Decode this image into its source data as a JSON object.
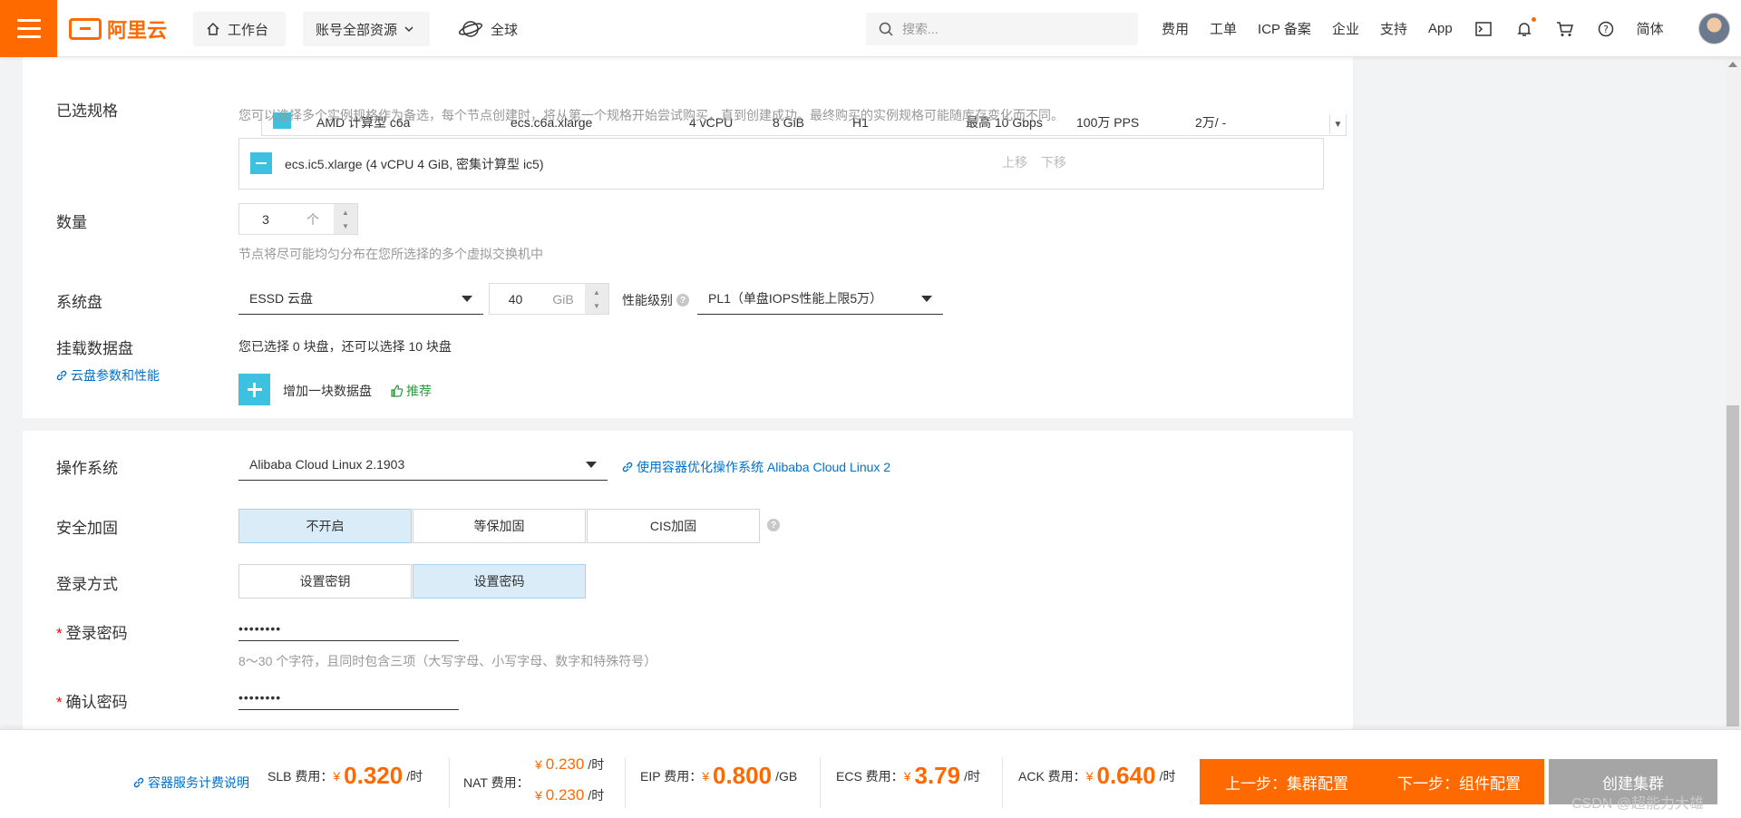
{
  "topbar": {
    "logo_text": "阿里云",
    "workbench": "工作台",
    "resources": "账号全部资源",
    "region": "全球",
    "search_placeholder": "搜索...",
    "links": [
      "费用",
      "工单",
      "ICP 备案",
      "企业",
      "支持",
      "App"
    ],
    "lang": "简体"
  },
  "instance_table_row": {
    "family": "AMD 计算型 c6a",
    "spec": "ecs.c6a.xlarge",
    "vcpu": "4 vCPU",
    "mem": "8 GiB",
    "gpu": "H1",
    "bandwidth": "最高 10 Gbps",
    "pps": "100万 PPS",
    "price": "2万/ -"
  },
  "selected_spec": {
    "label": "已选规格",
    "hint": "您可以选择多个实例规格作为备选，每个节点创建时，将从第一个规格开始尝试购买，直到创建成功。最终购买的实例规格可能随库存变化而不同。",
    "item": "ecs.ic5.xlarge (4 vCPU 4 GiB, 密集计算型 ic5)",
    "move_up": "上移",
    "move_down": "下移"
  },
  "quantity": {
    "label": "数量",
    "value": "3",
    "unit": "个",
    "hint": "节点将尽可能均匀分布在您所选择的多个虚拟交换机中"
  },
  "system_disk": {
    "label": "系统盘",
    "type": "ESSD 云盘",
    "size": "40",
    "size_unit": "GiB",
    "perf_label": "性能级别",
    "perf_value": "PL1（单盘IOPS性能上限5万）"
  },
  "data_disk": {
    "label": "挂载数据盘",
    "link": "云盘参数和性能",
    "status": "您已选择 0 块盘，还可以选择 10 块盘",
    "add_label": "增加一块数据盘",
    "recommend": "推荐"
  },
  "os": {
    "label": "操作系统",
    "value": "Alibaba Cloud Linux 2.1903",
    "link": "使用容器优化操作系统 Alibaba Cloud Linux 2"
  },
  "security": {
    "label": "安全加固",
    "options": [
      "不开启",
      "等保加固",
      "CIS加固"
    ]
  },
  "login": {
    "label": "登录方式",
    "options": [
      "设置密钥",
      "设置密码"
    ]
  },
  "password": {
    "label": "登录密码",
    "value": "••••••••",
    "hint": "8～30 个字符，且同时包含三项（大写字母、小写字母、数字和特殊符号）"
  },
  "confirm_password": {
    "label": "确认密码",
    "value": "••••••••"
  },
  "bottom": {
    "pricing_link": "容器服务计费说明",
    "slb_label": "SLB 费用：",
    "slb_value": "0.320",
    "nat_label": "NAT 费用：",
    "nat_value_1": "0.230",
    "nat_value_2": "0.230",
    "eip_label": "EIP 费用：",
    "eip_value": "0.800",
    "ecs_label": "ECS 费用：",
    "ecs_value": "3.79",
    "ack_label": "ACK 费用：",
    "ack_value": "0.640",
    "currency": "¥",
    "per_hour": "/时",
    "per_gb": "/GB",
    "prev_button": "上一步：集群配置",
    "next_button": "下一步：组件配置",
    "create_button": "创建集群"
  },
  "watermark": "CSDN @超能力大雄",
  "colors": {
    "brand": "#ff6a00",
    "link": "#0070cc",
    "selected_bg": "#d9ecf8",
    "accent_button": "#3ec0e0",
    "disabled_button": "#a5a5a5"
  }
}
